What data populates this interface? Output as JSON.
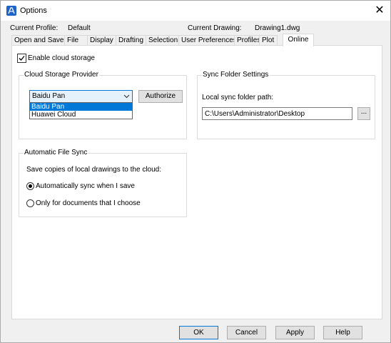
{
  "window": {
    "title": "Options",
    "close_glyph": "✕"
  },
  "header": {
    "profile_label": "Current Profile:",
    "profile_value": "Default",
    "drawing_label": "Current Drawing:",
    "drawing_value": "Drawing1.dwg"
  },
  "tabs": [
    {
      "label": "Open and Save"
    },
    {
      "label": "File"
    },
    {
      "label": "Display"
    },
    {
      "label": "Drafting"
    },
    {
      "label": "Selection"
    },
    {
      "label": "User Preferences"
    },
    {
      "label": "Profiles"
    },
    {
      "label": "Plot"
    },
    {
      "label": "Online",
      "active": true
    }
  ],
  "online": {
    "enable_cloud": {
      "label": "Enable cloud storage",
      "checked": true
    },
    "provider_group": {
      "title": "Cloud Storage Provider",
      "selected": "Baidu Pan",
      "options": [
        "Baidu Pan",
        "Huawei Cloud"
      ],
      "authorize_label": "Authorize"
    },
    "sync_group": {
      "title": "Sync Folder Settings",
      "path_label": "Local sync folder path:",
      "path_value": "C:\\Users\\Administrator\\Desktop",
      "browse_label": "..."
    },
    "auto_sync_group": {
      "title": "Automatic File Sync",
      "description": "Save copies of local drawings to the cloud:",
      "option_auto": "Automatically sync when I save",
      "option_choose": "Only for documents that I choose",
      "selected": "auto"
    }
  },
  "footer": {
    "ok_label": "OK",
    "cancel_label": "Cancel",
    "apply_label": "Apply",
    "help_label": "Help"
  },
  "colors": {
    "accent": "#0078d7",
    "selected_bg": "#e5f1fb",
    "app_icon": "#1e63c8"
  },
  "icons": {
    "app": "options-app-icon",
    "close": "close-icon",
    "check": "checkmark-icon",
    "chevron": "chevron-down-icon"
  }
}
